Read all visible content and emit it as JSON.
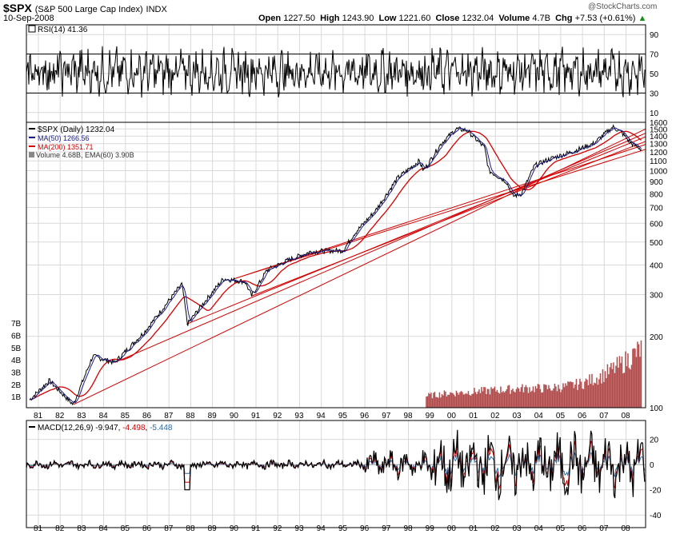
{
  "header": {
    "symbol": "$SPX",
    "name": "(S&P 500 Large Cap Index)",
    "exchange": "INDX",
    "date": "10-Sep-2008",
    "watermark": "@StockCharts.com",
    "open_label": "Open",
    "open": "1227.50",
    "high_label": "High",
    "high": "1243.90",
    "low_label": "Low",
    "low": "1221.60",
    "close_label": "Close",
    "close": "1232.04",
    "volume_label": "Volume",
    "volume": "4.7B",
    "chg_label": "Chg",
    "chg": "+7.53 (+0.61%)"
  },
  "legend": {
    "rsi": "RSI(14) 41.36",
    "price": "$SPX (Daily) 1232.04",
    "ma50": "MA(50) 1266.56",
    "ma200": "MA(200) 1351.71",
    "volume": "Volume 4.68B, EMA(60) 3.90B",
    "macd_prefix": "MACD(12,26,9)",
    "macd_v1": "-9.947",
    "macd_v2": "-4.498",
    "macd_v3": "-5.448"
  },
  "colors": {
    "price": "#000000",
    "ma50": "#1a1a8c",
    "ma200": "#d40000",
    "volume": "#b24b4b",
    "trendline": "#d40000",
    "macd": "#000000",
    "signal": "#d40000",
    "histogram": "#2c6ea8",
    "grid": "#d9d9d9"
  },
  "chart_data": [
    {
      "type": "line",
      "panel": "RSI",
      "ylim": [
        0,
        100
      ],
      "y_ticks": [
        "10",
        "30",
        "50",
        "70",
        "90"
      ],
      "reference_lines": [
        30,
        70
      ],
      "last_value": 41.36
    },
    {
      "type": "line",
      "panel": "Price",
      "scale": "log",
      "ylim": [
        100,
        1600
      ],
      "y_ticks": [
        "100",
        "200",
        "300",
        "400",
        "500",
        "600",
        "700",
        "800",
        "900",
        "1000",
        "1100",
        "1200",
        "1300",
        "1400",
        "1500",
        "1600"
      ],
      "x_ticks": [
        "81",
        "82",
        "83",
        "84",
        "85",
        "86",
        "87",
        "88",
        "89",
        "90",
        "91",
        "92",
        "93",
        "94",
        "95",
        "96",
        "97",
        "98",
        "99",
        "00",
        "01",
        "02",
        "03",
        "04",
        "05",
        "06",
        "07",
        "08"
      ],
      "volume_ticks": [
        "1B",
        "2B",
        "3B",
        "4B",
        "5B",
        "6B",
        "7B"
      ],
      "series": [
        {
          "name": "$SPX (Daily)",
          "x": [
            1980.6,
            1981.5,
            1982.6,
            1983.5,
            1984.5,
            1985.9,
            1987.6,
            1987.85,
            1988.5,
            1989.5,
            1990.5,
            1990.8,
            1991.5,
            1992.5,
            1993.5,
            1994.5,
            1995.0,
            1995.5,
            1996.5,
            1997.5,
            1998.5,
            1998.7,
            1999.5,
            2000.2,
            2000.7,
            2001.5,
            2001.7,
            2002.5,
            2002.8,
            2003.2,
            2003.8,
            2004.5,
            2005.5,
            2006.5,
            2007.4,
            2007.8,
            2008.2,
            2008.7
          ],
          "y": [
            108,
            130,
            103,
            165,
            155,
            210,
            333,
            225,
            270,
            350,
            340,
            296,
            380,
            420,
            455,
            460,
            460,
            540,
            680,
            930,
            1100,
            1000,
            1300,
            1500,
            1480,
            1250,
            1000,
            900,
            780,
            800,
            1050,
            1120,
            1200,
            1300,
            1530,
            1450,
            1310,
            1232
          ]
        },
        {
          "name": "MA(50)",
          "last": 1266.56
        },
        {
          "name": "MA(200)",
          "last": 1351.71
        }
      ],
      "volume": {
        "start": 1998.8,
        "end": 2008.7,
        "values_B": [
          1.0,
          1.2,
          1.3,
          1.4,
          1.5,
          1.6,
          1.6,
          1.7,
          2.0,
          2.6,
          3.5,
          4.68
        ],
        "ema60_last_B": 3.9
      }
    },
    {
      "type": "line",
      "panel": "MACD",
      "ylim": [
        -50,
        35
      ],
      "y_ticks": [
        "20",
        "0",
        "-20",
        "-40"
      ],
      "x_ticks": [
        "81",
        "82",
        "83",
        "84",
        "85",
        "86",
        "87",
        "88",
        "89",
        "90",
        "91",
        "92",
        "93",
        "94",
        "95",
        "96",
        "97",
        "98",
        "99",
        "00",
        "01",
        "02",
        "03",
        "04",
        "05",
        "06",
        "07",
        "08"
      ],
      "series": [
        {
          "name": "MACD",
          "last": -9.947
        },
        {
          "name": "Signal",
          "last": -4.498
        },
        {
          "name": "Histogram",
          "last": -5.448
        }
      ]
    }
  ]
}
